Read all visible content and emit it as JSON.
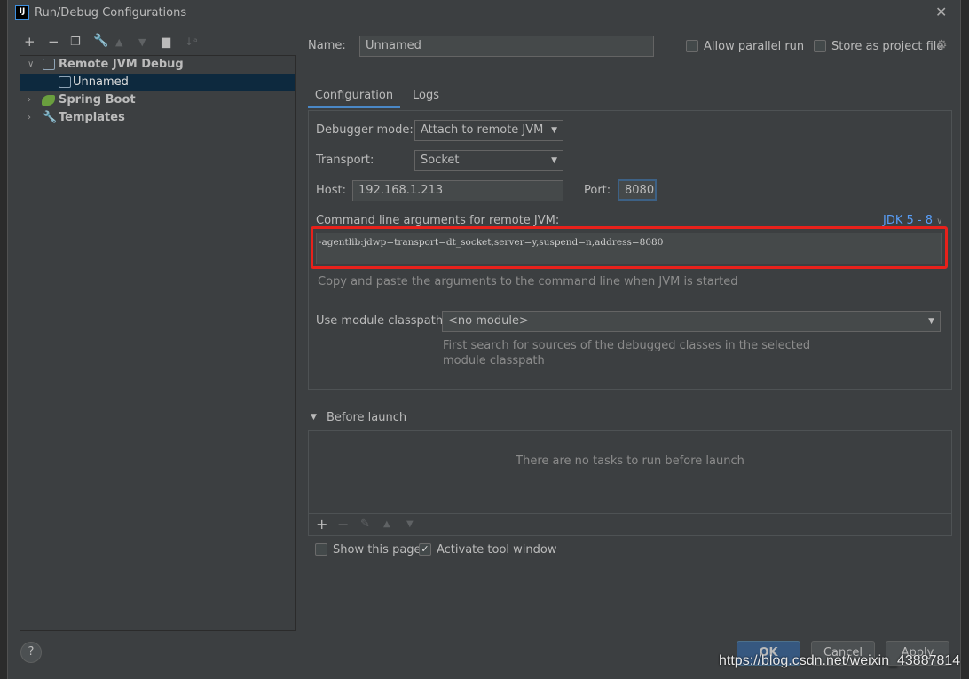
{
  "window": {
    "title": "Run/Debug Configurations",
    "logo": "IJ"
  },
  "toolbar": {
    "icons": [
      "plus-icon",
      "minus-icon",
      "copy-icon",
      "wrench-icon",
      "arrow-up-icon",
      "arrow-down-icon",
      "new-folder-icon",
      "sort-icon"
    ]
  },
  "tree": {
    "items": [
      {
        "label": "Remote JVM Debug",
        "expanded": true
      },
      {
        "label": "Unnamed",
        "selected": true
      },
      {
        "label": "Spring Boot"
      },
      {
        "label": "Templates"
      }
    ]
  },
  "form": {
    "name_label": "Name:",
    "name_value": "Unnamed",
    "allow_parallel": "Allow parallel run",
    "store_project": "Store as project file",
    "tabs": [
      "Configuration",
      "Logs"
    ],
    "debugger_mode_label": "Debugger mode:",
    "debugger_mode_value": "Attach to remote JVM",
    "transport_label": "Transport:",
    "transport_value": "Socket",
    "host_label": "Host:",
    "host_value": "192.168.1.213",
    "port_label": "Port:",
    "port_value": "8080",
    "cmd_label": "Command line arguments for remote JVM:",
    "jdk_link": "JDK 5 - 8",
    "cmd_value": "-agentlib:jdwp=transport=dt_socket,server=y,suspend=n,address=8080",
    "cmd_hint": "Copy and paste the arguments to the command line when JVM is started",
    "module_label": "Use module classpath:",
    "module_value": "<no module>",
    "module_hint1": "First search for sources of the debugged classes in the selected",
    "module_hint2": "module classpath",
    "before_launch": "Before launch",
    "no_tasks": "There are no tasks to run before launch",
    "show_page": "Show this page",
    "activate_tool": "Activate tool window",
    "highlight_color": "#e8211b",
    "accent": "#589df6"
  },
  "buttons": {
    "help": "?",
    "ok": "OK",
    "cancel": "Cancel",
    "apply": "Apply"
  },
  "watermark": "https://blog.csdn.net/weixin_43887814"
}
